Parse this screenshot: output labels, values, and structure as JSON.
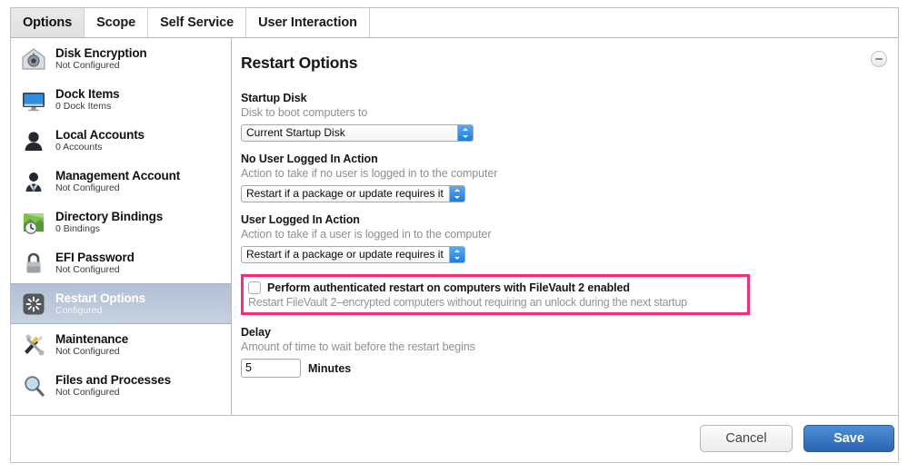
{
  "tabs": [
    {
      "label": "Options",
      "active": true
    },
    {
      "label": "Scope",
      "active": false
    },
    {
      "label": "Self Service",
      "active": false
    },
    {
      "label": "User Interaction",
      "active": false
    }
  ],
  "sidebar": {
    "items": [
      {
        "title": "Disk Encryption",
        "sub": "Not Configured",
        "icon": "disk-encryption-icon",
        "selected": false
      },
      {
        "title": "Dock Items",
        "sub": "0 Dock Items",
        "icon": "dock-items-icon",
        "selected": false
      },
      {
        "title": "Local Accounts",
        "sub": "0 Accounts",
        "icon": "local-accounts-icon",
        "selected": false
      },
      {
        "title": "Management Account",
        "sub": "Not Configured",
        "icon": "management-account-icon",
        "selected": false
      },
      {
        "title": "Directory Bindings",
        "sub": "0 Bindings",
        "icon": "directory-bindings-icon",
        "selected": false
      },
      {
        "title": "EFI Password",
        "sub": "Not Configured",
        "icon": "efi-password-icon",
        "selected": false
      },
      {
        "title": "Restart Options",
        "sub": "Configured",
        "icon": "restart-options-icon",
        "selected": true
      },
      {
        "title": "Maintenance",
        "sub": "Not Configured",
        "icon": "maintenance-icon",
        "selected": false
      },
      {
        "title": "Files and Processes",
        "sub": "Not Configured",
        "icon": "files-processes-icon",
        "selected": false
      }
    ]
  },
  "panel": {
    "title": "Restart Options",
    "collapse_icon": "minus-circle-icon",
    "startup_disk": {
      "label": "Startup Disk",
      "help": "Disk to boot computers to",
      "value": "Current Startup Disk"
    },
    "no_user_action": {
      "label": "No User Logged In Action",
      "help": "Action to take if no user is logged in to the computer",
      "value": "Restart if a package or update requires it"
    },
    "user_action": {
      "label": "User Logged In Action",
      "help": "Action to take if a user is logged in to the computer",
      "value": "Restart if a package or update requires it"
    },
    "authenticated_restart": {
      "label": "Perform authenticated restart on computers with FileVault 2 enabled",
      "help": "Restart FileVault 2–encrypted computers without requiring an unlock during the next startup",
      "checked": false,
      "highlight_color": "#fa2d72"
    },
    "delay": {
      "label": "Delay",
      "help": "Amount of time to wait before the restart begins",
      "value": "5",
      "unit": "Minutes"
    }
  },
  "footer": {
    "cancel_label": "Cancel",
    "save_label": "Save"
  },
  "colors": {
    "accent": "#2a64b4",
    "highlight": "#fa2d72",
    "selection": "#b2c0d4"
  }
}
